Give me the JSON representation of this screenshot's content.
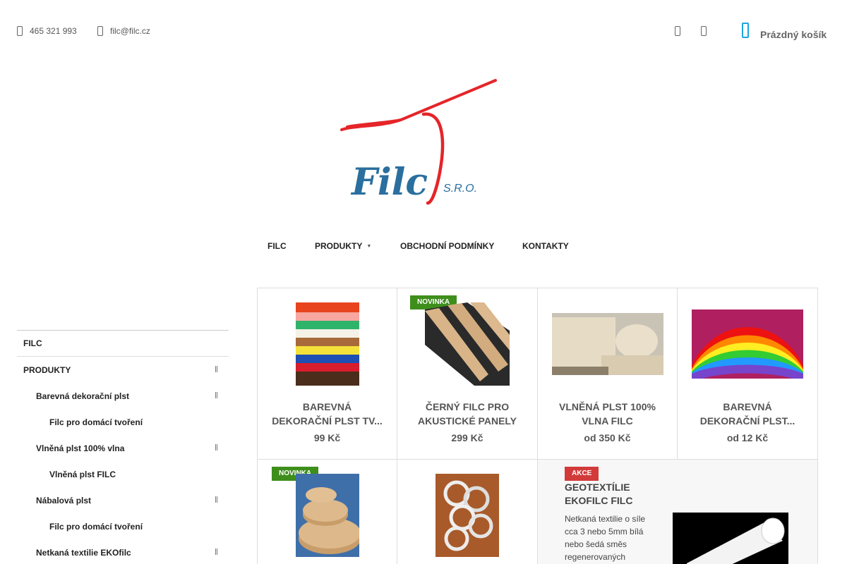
{
  "header": {
    "phone": "465 321 993",
    "email": "filc@filc.cz",
    "cart_label": "Prázdný košík",
    "icons": [
      "phone-icon",
      "mail-icon",
      "search-icon",
      "user-icon",
      "cart-icon"
    ]
  },
  "logo": {
    "text": "Filc",
    "suffix": "S.R.O.",
    "colors": {
      "stroke": "#e52529",
      "text": "#2a6f9e"
    }
  },
  "nav": {
    "items": [
      "FILC",
      "PRODUKTY",
      "OBCHODNÍ PODMÍNKY",
      "KONTAKTY"
    ]
  },
  "sidebar": {
    "items": [
      {
        "label": "FILC"
      },
      {
        "label": "PRODUKTY"
      },
      {
        "label": "Barevná dekorační plst"
      },
      {
        "label": "Filc pro domácí tvoření"
      },
      {
        "label": "Vlněná plst 100% vlna"
      },
      {
        "label": "Vlněná plst FILC"
      },
      {
        "label": "Nábalová plst"
      },
      {
        "label": "Filc pro domácí tvoření"
      },
      {
        "label": "Netkaná textilie EKOfilc"
      }
    ]
  },
  "products": [
    {
      "line1": "BAREVNÁ",
      "line2": "DEKORAČNÍ PLST TV...",
      "price": "99 Kč",
      "badge": ""
    },
    {
      "line1": "ČERNÝ FILC PRO",
      "line2": "AKUSTICKÉ PANELY",
      "price": "299 Kč",
      "badge": "NOVINKA"
    },
    {
      "line1": "VLNĚNÁ PLST 100%",
      "line2": "VLNA FILC",
      "price": "od 350 Kč",
      "badge": ""
    },
    {
      "line1": "BAREVNÁ",
      "line2": "DEKORAČNÍ PLST...",
      "price": "od 12 Kč",
      "badge": ""
    },
    {
      "line1": "",
      "line2": "",
      "price": "",
      "badge": "NOVINKA"
    },
    {
      "line1": "",
      "line2": "",
      "price": "",
      "badge": ""
    }
  ],
  "featured": {
    "badge": "AKCE",
    "title_line1": "GEOTEXTÍLIE",
    "title_line2": "EKOFILC FILC",
    "description": "Netkaná textilie o síle cca 3 nebo 5mm bílá nebo šedá směs regenerovaných"
  },
  "colors": {
    "accent": "#1ea4dc",
    "badge_new": "#3e8e1c",
    "badge_sale": "#d33a3a"
  }
}
